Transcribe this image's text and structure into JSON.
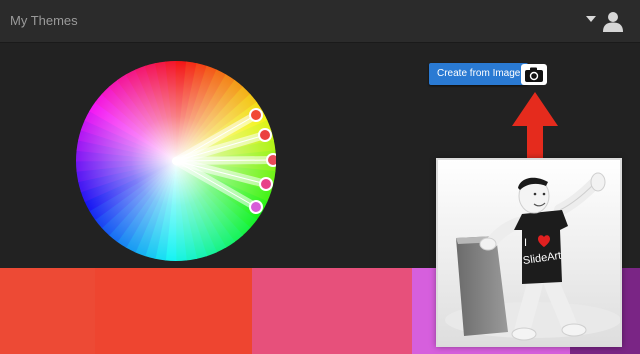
{
  "header": {
    "title": "My Themes",
    "caret_icon": "caret-down-icon",
    "avatar_icon": "user-avatar-icon"
  },
  "color_wheel": {
    "handle_colors": [
      "#f14a35",
      "#eb3f3f",
      "#e84a58",
      "#e8428a",
      "#d75ed8"
    ]
  },
  "actions": {
    "create_from_image_label": "Create from Image",
    "camera_icon": "camera-icon",
    "arrow_color": "#e52b1d"
  },
  "swatches": [
    {
      "color": "#ed4a35"
    },
    {
      "color": "#ee4530"
    },
    {
      "color": "#e7507b"
    },
    {
      "color": "#d65fdd"
    },
    {
      "color": "#7a2585"
    }
  ],
  "photo": {
    "shirt_text": [
      "I",
      "SlideArt"
    ],
    "heart_color": "#e02020"
  }
}
